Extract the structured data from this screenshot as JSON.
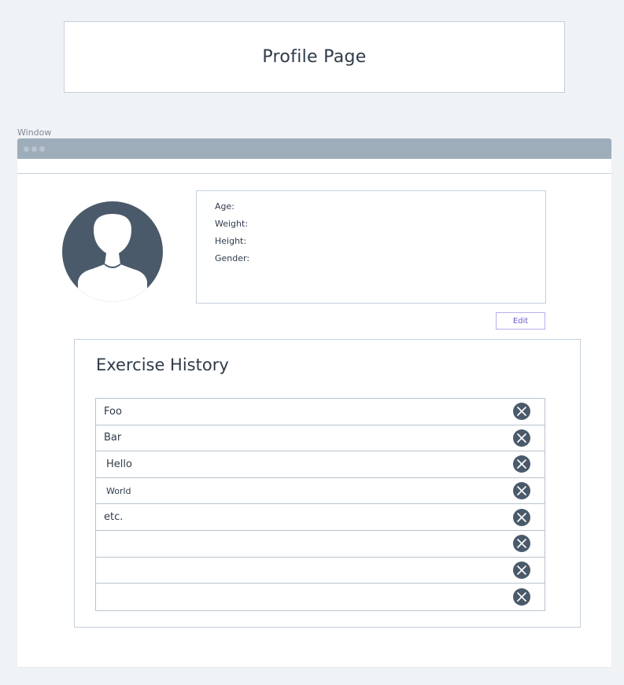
{
  "header": {
    "title": "Profile Page"
  },
  "window": {
    "label": "Window"
  },
  "profile": {
    "fields": [
      {
        "label": "Age:"
      },
      {
        "label": "Weight:"
      },
      {
        "label": "Height:"
      },
      {
        "label": "Gender:"
      }
    ],
    "edit_label": "Edit"
  },
  "history": {
    "title": "Exercise History",
    "items": [
      {
        "label": "Foo"
      },
      {
        "label": "Bar"
      },
      {
        "label": "Hello"
      },
      {
        "label": "World"
      },
      {
        "label": "etc."
      },
      {
        "label": ""
      },
      {
        "label": ""
      },
      {
        "label": ""
      }
    ]
  },
  "colors": {
    "background": "#f0f3f6",
    "titlebar": "#9eadba",
    "border": "#c5d0db",
    "icon_dark": "#4a5a6a",
    "edit_accent": "#6a5acd"
  },
  "icons": {
    "avatar": "user-silhouette-icon",
    "delete": "close-circle-icon"
  }
}
